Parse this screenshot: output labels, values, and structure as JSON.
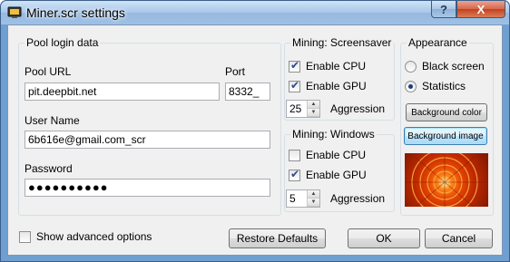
{
  "window": {
    "title": "Miner.scr settings",
    "help_label": "?",
    "close_label": "X"
  },
  "pool": {
    "legend": "Pool login data",
    "url_label": "Pool URL",
    "url_value": "pit.deepbit.net",
    "port_label": "Port",
    "port_value": "8332_",
    "user_label": "User Name",
    "user_value": "6b616e@gmail.com_scr",
    "password_label": "Password",
    "password_value": "●●●●●●●●●●"
  },
  "screensaver": {
    "legend": "Mining: Screensaver",
    "cpu_label": "Enable CPU",
    "cpu_checked": true,
    "gpu_label": "Enable GPU",
    "gpu_checked": true,
    "aggression_value": "25",
    "aggression_label": "Aggression"
  },
  "windows": {
    "legend": "Mining: Windows",
    "cpu_label": "Enable CPU",
    "cpu_checked": false,
    "gpu_label": "Enable GPU",
    "gpu_checked": true,
    "aggression_value": "5",
    "aggression_label": "Aggression"
  },
  "appearance": {
    "legend": "Appearance",
    "black_label": "Black screen",
    "stats_label": "Statistics",
    "selected": "Statistics",
    "bg_color_label": "Background color",
    "bg_image_label": "Background image",
    "preview_icon": "orange-flower-image"
  },
  "footer": {
    "advanced_label": "Show advanced options",
    "advanced_checked": false,
    "restore_label": "Restore Defaults",
    "ok_label": "OK",
    "cancel_label": "Cancel"
  },
  "colors": {
    "titlebar": "#a7c6e8",
    "close_button": "#c4411f",
    "dialog_bg": "#f0f0f0",
    "focus_button": "#3c7fb1"
  }
}
